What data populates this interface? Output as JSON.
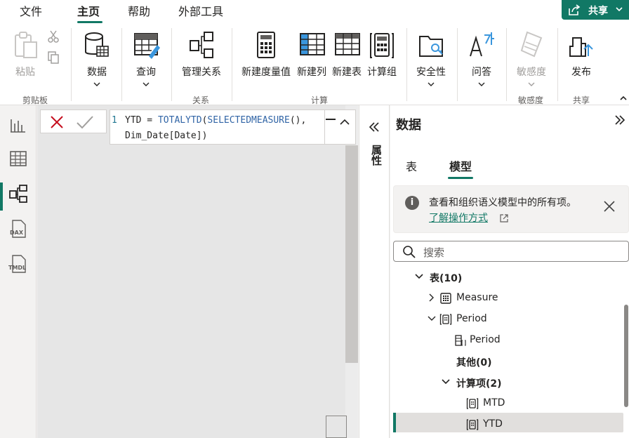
{
  "menu": {
    "file": "文件",
    "home": "主页",
    "help": "帮助",
    "external_tools": "外部工具",
    "share": "共享"
  },
  "ribbon": {
    "paste": "粘贴",
    "clipboard_group": "剪贴板",
    "data": "数据",
    "query": "查询",
    "manage_relationships": "管理关系",
    "relationships_group": "关系",
    "new_measure": "新建度量值",
    "new_column": "新建列",
    "new_table": "新建表",
    "calc_group": "计算组",
    "calculations_group": "计算",
    "security": "安全性",
    "qa": "问答",
    "sensitivity": "敏感度",
    "sensitivity_group": "敏感度",
    "publish": "发布",
    "share_group": "共享"
  },
  "formula": {
    "line_number": "1",
    "line1_name": "YTD",
    "line1_eq": " = ",
    "line1_fn": "TOTALYTD",
    "line1_p1": "(",
    "line1_fn2": "SELECTEDMEASURE",
    "line1_p2": "(),",
    "line2_ref": "Dim_Date",
    "line2_b1": "[",
    "line2_col": "Date",
    "line2_b2": "])"
  },
  "properties_pane": {
    "title": "属性"
  },
  "data_pane": {
    "title": "数据",
    "tab_tables": "表",
    "tab_model": "模型",
    "info_text": "查看和组织语义模型中的所有项。",
    "info_link": "了解操作方式",
    "search_placeholder": "搜索",
    "tree": {
      "tables": "表(10)",
      "measure": "Measure",
      "period": "Period",
      "period_child": "Period",
      "other": "其他(0)",
      "calc_items": "计算项(2)",
      "mtd": "MTD",
      "ytd": "YTD"
    }
  },
  "colors": {
    "accent": "#117865",
    "dax_function": "#3165a6",
    "line_number": "#237893"
  }
}
